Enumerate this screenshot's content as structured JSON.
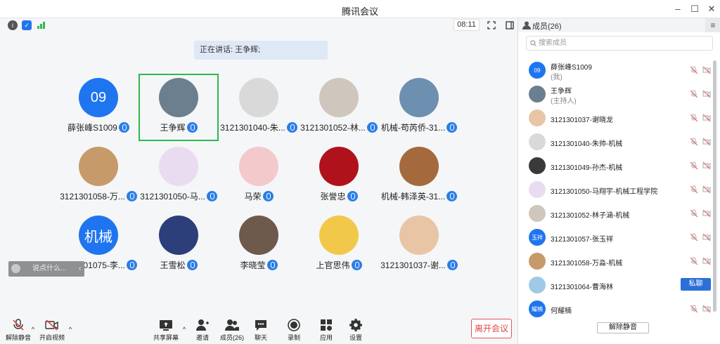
{
  "window": {
    "title": "腾讯会议"
  },
  "topbar": {
    "timer": "08:11"
  },
  "speaking": {
    "text": "正在讲话: 王争辉;"
  },
  "tiles": [
    {
      "name": "薛张峰S1009",
      "initial": "09",
      "color": "#1f75f0"
    },
    {
      "name": "王争辉",
      "color": "#6b7f8e"
    },
    {
      "name": "3121301040-朱...",
      "color": "#d9d9d9"
    },
    {
      "name": "3121301052-林...",
      "color": "#cfc7bd"
    },
    {
      "name": "机械-苟芮侨-31...",
      "color": "#6d8fb0"
    },
    {
      "name": "3121301058-万...",
      "color": "#c79a6a"
    },
    {
      "name": "3121301050-马...",
      "color": "#eadcf0"
    },
    {
      "name": "马荣",
      "color": "#f3c9cc"
    },
    {
      "name": "张誉忠",
      "color": "#b0121c"
    },
    {
      "name": "机械-韩泽英-31...",
      "color": "#a46a3e"
    },
    {
      "name": "3121301075-李...",
      "initial": "机械",
      "color": "#1f75f0"
    },
    {
      "name": "王雪松",
      "color": "#2d3f7a"
    },
    {
      "name": "李晓莹",
      "color": "#6e5a4d"
    },
    {
      "name": "上官思伟",
      "color": "#f2c84a"
    },
    {
      "name": "3121301037-谢...",
      "color": "#e8c5a5"
    }
  ],
  "chat": {
    "placeholder": "说点什么..."
  },
  "toolbar": {
    "unmute": "解除静音",
    "video": "开启视频",
    "share": "共享屏幕",
    "invite": "邀请",
    "members": "成员(26)",
    "chat": "聊天",
    "record": "录制",
    "apps": "应用",
    "settings": "设置",
    "leave": "离开会议"
  },
  "panel": {
    "title": "成员(26)",
    "search_placeholder": "搜索成员",
    "mute_all": "解除静音",
    "dm": "私聊",
    "members": [
      {
        "name": "薛张峰S1009",
        "role": "(我)",
        "initial": "09",
        "color": "#1f75f0"
      },
      {
        "name": "王争辉",
        "role": "(主持人)",
        "color": "#6b7f8e"
      },
      {
        "name": "3121301037-谢晓龙",
        "color": "#e8c5a5"
      },
      {
        "name": "3121301040-朱帅-机械",
        "color": "#d9d9d9"
      },
      {
        "name": "3121301049-孙杰-机械",
        "color": "#3a3a3a"
      },
      {
        "name": "3121301050-马翔宇-机械工程学院",
        "color": "#eadcf0"
      },
      {
        "name": "3121301052-林子涵-机械",
        "color": "#cfc7bd"
      },
      {
        "name": "3121301057-张玉祥",
        "initial": "玉祥",
        "color": "#1f75f0"
      },
      {
        "name": "3121301058-万淼-机械",
        "color": "#c79a6a"
      },
      {
        "name": "3121301064-曹海林",
        "color": "#9fc9e6"
      },
      {
        "name": "何耀楠",
        "initial": "耀楠",
        "color": "#1f75f0"
      }
    ]
  },
  "colors": {
    "accent": "#1f75f0",
    "selected_border": "#2fb84d",
    "leave": "#e04645"
  }
}
